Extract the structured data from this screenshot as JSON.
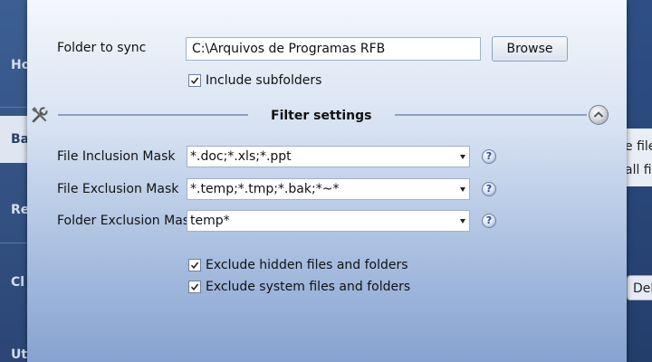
{
  "background": {
    "left_nav": [
      "Ho",
      "Ba",
      "Re",
      "Cl",
      "Ut"
    ],
    "right_fragments": [
      "e file",
      "all fi"
    ],
    "right_button": "Dele"
  },
  "dialog": {
    "folder_label": "Folder to sync",
    "folder_value": "C:\\Arquivos de Programas RFB",
    "browse_label": "Browse",
    "include_subfolders": {
      "label": "Include subfolders",
      "checked": true
    },
    "section_title": "Filter settings",
    "tools_icon": "tools-icon",
    "collapse_icon": "collapse-up-icon",
    "help_glyph": "?",
    "filters": [
      {
        "label": "File Inclusion Mask",
        "value": "*.doc;*.xls;*.ppt"
      },
      {
        "label": "File Exclusion Mask",
        "value": "*.temp;*.tmp;*.bak;*~*"
      },
      {
        "label": "Folder Exclusion Mask",
        "value": "temp*"
      }
    ],
    "exclude_hidden": {
      "label": "Exclude hidden files and folders",
      "checked": true
    },
    "exclude_system": {
      "label": "Exclude system files and folders",
      "checked": true
    }
  }
}
